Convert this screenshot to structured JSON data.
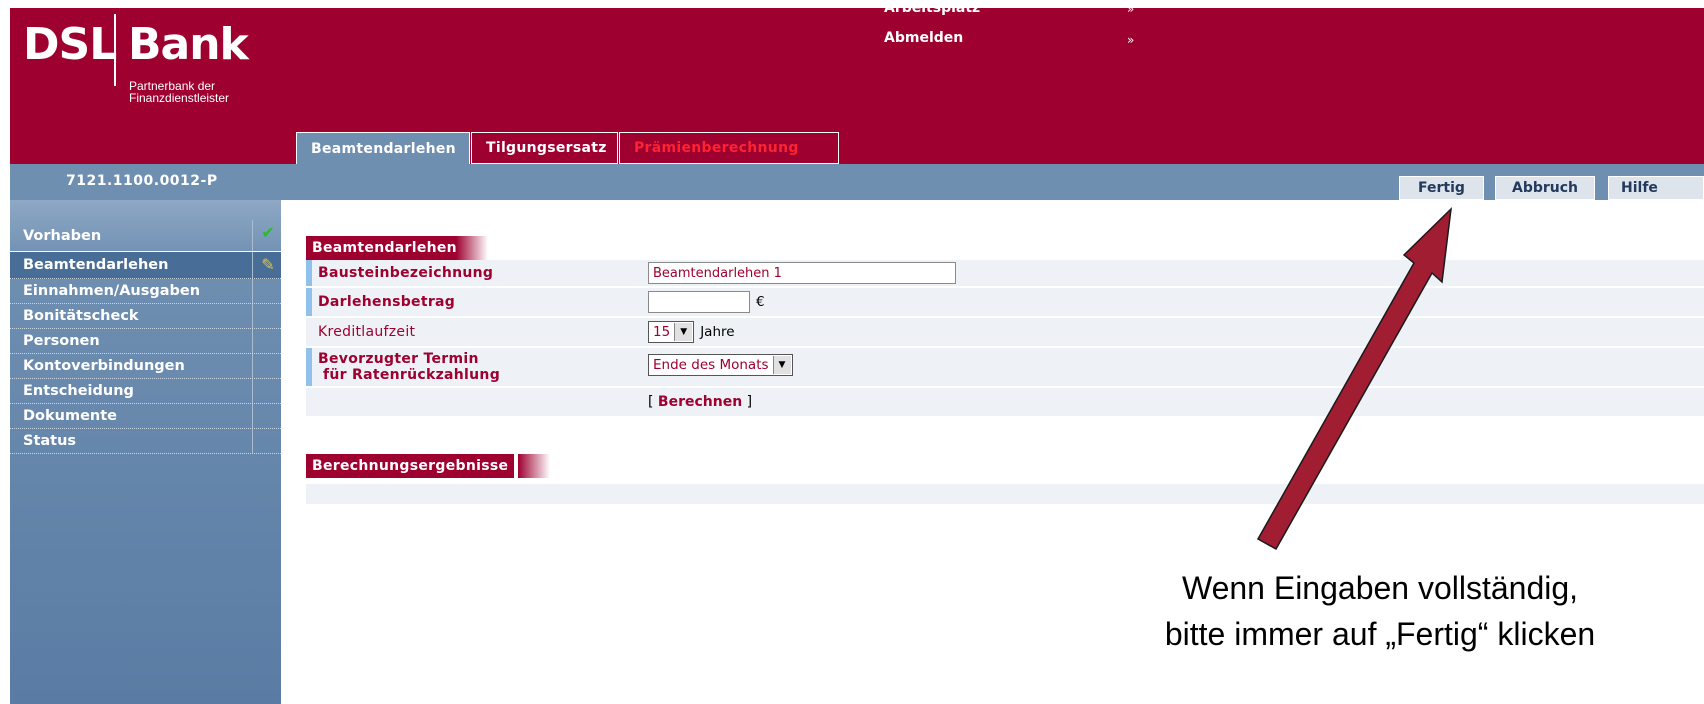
{
  "logo": {
    "part1": "DSL",
    "part2": "Bank",
    "sub_line1": "Partnerbank der",
    "sub_line2": "Finanzdienstleister"
  },
  "header": {
    "link1": "Arbeitsplatz",
    "link2": "Abmelden",
    "arrow": "»"
  },
  "tabs": [
    {
      "label": "Beamtendarlehen"
    },
    {
      "label": "Tilgungsersatz"
    },
    {
      "label": "Prämienberechnung"
    }
  ],
  "account_id": "7121.1100.0012-P",
  "buttons": {
    "done": "Fertig",
    "cancel": "Abbruch",
    "help": "Hilfe"
  },
  "sidebar": {
    "items": [
      {
        "label": "Vorhaben",
        "status_icon": "check-icon"
      },
      {
        "label": "Beamtendarlehen",
        "status_icon": "broom-icon"
      },
      {
        "label": "Einnahmen/Ausgaben"
      },
      {
        "label": "Bonitätscheck"
      },
      {
        "label": "Personen"
      },
      {
        "label": "Kontoverbindungen"
      },
      {
        "label": "Entscheidung"
      },
      {
        "label": "Dokumente"
      },
      {
        "label": "Status"
      }
    ]
  },
  "form": {
    "section_title": "Beamtendarlehen",
    "fields": {
      "designation_label": "Bausteinbezeichnung",
      "designation_value": "Beamtendarlehen 1",
      "amount_label": "Darlehensbetrag",
      "amount_value": "",
      "currency": "€",
      "term_label": "Kreditlaufzeit",
      "term_value": "15",
      "term_unit": "Jahre",
      "date_label_line1": "Bevorzugter Termin",
      "date_label_line2": "für Ratenrückzahlung",
      "date_value": "Ende des Monats"
    },
    "calc_open": "[",
    "calc_link": "Berechnen",
    "calc_close": "]",
    "results_title": "Berechnungsergebnisse"
  },
  "annotation": {
    "line1": "Wenn Eingaben vollständig,",
    "line2": "bitte immer auf „Fertig“ klicken"
  },
  "colors": {
    "brand": "#9e0030",
    "nav_blue": "#6f8fb1",
    "row_bg": "#eef2f6",
    "mark": "#8fc1ea",
    "arrow": "#a01d32"
  }
}
